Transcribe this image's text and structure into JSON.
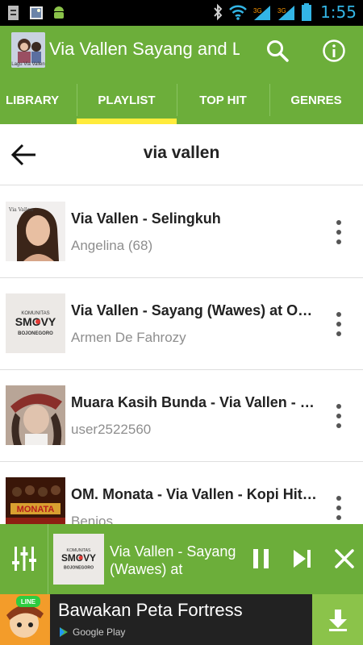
{
  "status_bar": {
    "time": "1:55"
  },
  "app_bar": {
    "logo_caption": "Lagu Via Vallen",
    "title": "Via Vallen Sayang and Lagu",
    "search_icon": "search-icon",
    "info_icon": "info-icon"
  },
  "tabs": [
    {
      "label": "LIBRARY",
      "active": false
    },
    {
      "label": "PLAYLIST",
      "active": true
    },
    {
      "label": "TOP HIT",
      "active": false
    },
    {
      "label": "GENRES",
      "active": false
    }
  ],
  "header": {
    "title": "via vallen"
  },
  "tracks": [
    {
      "title": "Via Vallen - Selingkuh",
      "subtitle": "Angelina (68)"
    },
    {
      "title": "Via Vallen - Sayang (Wawes) at Om Smovy",
      "subtitle": "Armen De Fahrozy"
    },
    {
      "title": "Muara Kasih Bunda - Via Vallen - Live",
      "subtitle": "user2522560"
    },
    {
      "title": "OM. Monata - Via Vallen - Kopi Hitam",
      "subtitle": "Benios"
    }
  ],
  "thumb_text": {
    "smovy_top": "KOMUNITAS",
    "smovy_main": "SMOVY",
    "smovy_bottom": "BOJONEGORO",
    "monata": "MONATA",
    "via_sig": "Via Vallen"
  },
  "player": {
    "title": "Via Vallen - Sayang (Wawes) at"
  },
  "ad": {
    "title": "Bawakan Peta Fortress",
    "store": "Google Play",
    "badge": "LINE"
  },
  "colors": {
    "primary_green": "#6cae3a",
    "tab_indicator": "#ffeb3b",
    "time_blue": "#33b5e5",
    "download_green": "#8bc34a"
  }
}
